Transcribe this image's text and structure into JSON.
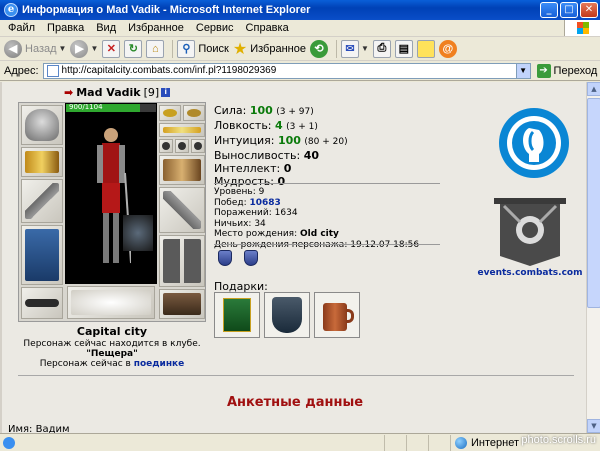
{
  "window": {
    "title": "Информация о Mad Vadik - Microsoft Internet Explorer"
  },
  "menu": [
    "Файл",
    "Правка",
    "Вид",
    "Избранное",
    "Сервис",
    "Справка"
  ],
  "toolbar": {
    "back": "Назад",
    "search": "Поиск",
    "favorites": "Избранное"
  },
  "address": {
    "label": "Адрес:",
    "url": "http://capitalcity.combats.com/inf.pl?1198029369",
    "go": "Переход"
  },
  "character": {
    "name": "Mad Vadik",
    "level": "[9]",
    "info_badge": "i",
    "hp": "900/1104",
    "hp_fraction": 0.82,
    "city": "Capital city",
    "club_text": "Персонаж сейчас находится в клубе.",
    "club_name": "\"Пещера\"",
    "fight_text": "Персонаж сейчас в",
    "fight_link": "поединке"
  },
  "stats": [
    {
      "label": "Сила:",
      "value": "100",
      "extra": "(3 + 97)",
      "green": true
    },
    {
      "label": "Ловкость:",
      "value": "4",
      "extra": "(3 + 1)",
      "green": true
    },
    {
      "label": "Интуиция:",
      "value": "100",
      "extra": "(80 + 20)",
      "green": true
    },
    {
      "label": "Выносливость:",
      "value": "40",
      "extra": "",
      "green": false
    },
    {
      "label": "Интеллект:",
      "value": "0",
      "extra": "",
      "green": false
    },
    {
      "label": "Мудрость:",
      "value": "0",
      "extra": "",
      "green": false
    }
  ],
  "details": {
    "level_label": "Уровень:",
    "level_value": "9",
    "wins_label": "Побед:",
    "wins_value": "10683",
    "losses_label": "Поражений:",
    "losses_value": "1634",
    "draws_label": "Ничьих:",
    "draws_value": "34",
    "birthplace_label": "Место рождения:",
    "birthplace_value": "Old city",
    "birthday_label": "День рождения персонажа:",
    "birthday_value": "19.12.07 18:56"
  },
  "gifts_label": "Подарки:",
  "events_link": "events.combats.com",
  "profile_heading": "Анкетные данные",
  "name_field": "Имя: Вадим",
  "status": {
    "zone": "Интернет"
  },
  "watermark": "photo.scrolls.ru",
  "colors": {
    "accent_green": "#0a7a0a",
    "link_blue": "#0a2b9e",
    "heading_red": "#a01010"
  }
}
